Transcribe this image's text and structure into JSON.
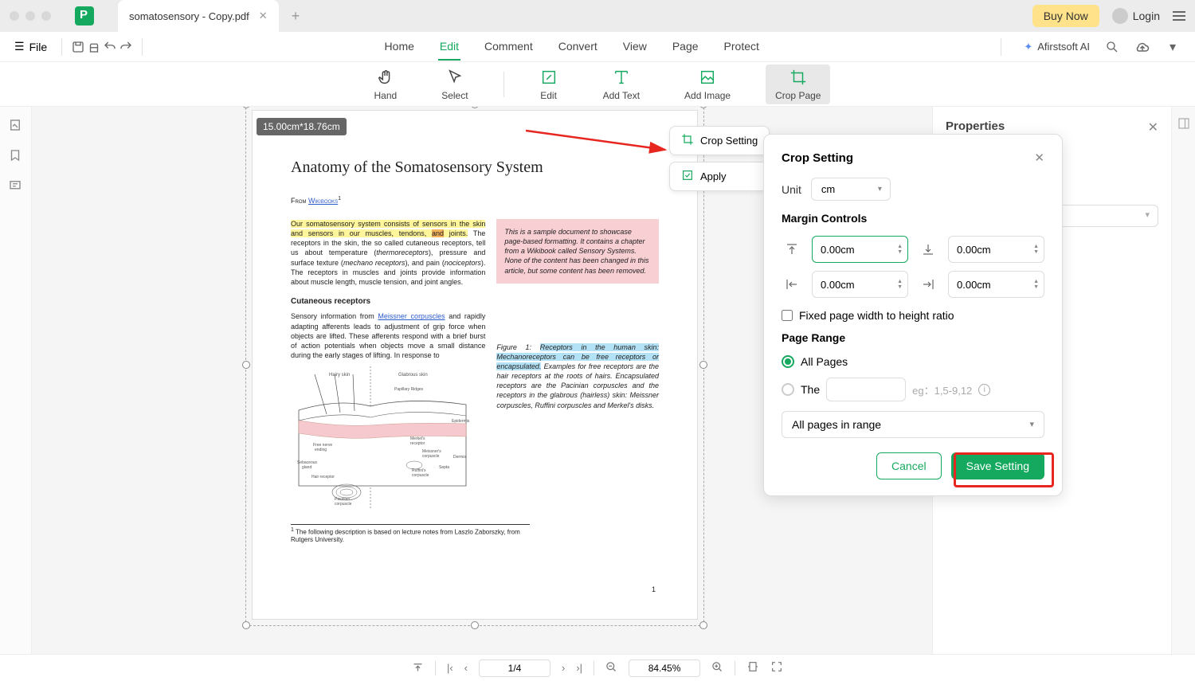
{
  "titlebar": {
    "tab_name": "somatosensory - Copy.pdf",
    "buy_now": "Buy Now",
    "login": "Login"
  },
  "menubar": {
    "file": "File",
    "items": [
      "Home",
      "Edit",
      "Comment",
      "Convert",
      "View",
      "Page",
      "Protect"
    ],
    "active_index": 1,
    "ai": "Afirstsoft AI"
  },
  "toolbar": {
    "items": [
      "Hand",
      "Select",
      "Edit",
      "Add Text",
      "Add Image",
      "Crop Page"
    ],
    "active_index": 5
  },
  "canvas": {
    "size_badge": "15.00cm*18.76cm",
    "float_crop_setting": "Crop Setting",
    "float_apply": "Apply"
  },
  "document": {
    "title": "Anatomy of the Somatosensory System",
    "from_label": "From ",
    "from_link": "Wikibooks",
    "body_hl1": "Our somatosensory system consists of sensors in the skin",
    "body_hl2": "and sensors in our muscles, tendons, ",
    "body_hl3": "and",
    "body_hl4": " joints.",
    "body_rest1": " The receptors in the skin, the so called cutaneous receptors, tell us about temperature (",
    "body_em1": "thermoreceptors",
    "body_rest2": "), pressure and surface texture (",
    "body_em2": "mechano receptors",
    "body_rest3": "), and pain (",
    "body_em3": "nociceptors",
    "body_rest4": "). The receptors in muscles and joints provide information about muscle length, muscle tension, and joint angles.",
    "pinkbox": "This is a sample document to showcase page-based formatting. It contains a chapter from a Wikibook called Sensory Systems. None of the content has been changed in this article, but some content has been removed.",
    "subhead": "Cutaneous receptors",
    "para2a": "Sensory information from ",
    "para2link": "Meissner corpuscles",
    "para2b": " and rapidly adapting afferents leads to adjustment of grip force when objects are lifted. These afferents respond with a brief burst of action potentials when objects move a small distance during the early stages of lifting. In response to",
    "fig_label": "Figure 1:",
    "fig_hl": "Receptors in the human skin: Mechanoreceptors can be free receptors or encapsulated.",
    "fig_rest": " Examples for free receptors are the hair receptors at the roots of hairs. Encapsulated receptors are the Pacinian corpuscles and the receptors in the glabrous (hairless) skin: Meissner corpuscles, Ruffini corpuscles and Merkel's disks.",
    "diagram_labels": [
      "Hairy skin",
      "Glabrous skin",
      "Papillary Ridges",
      "Epidermis",
      "Dermis",
      "Free nerve ending",
      "Merkel's receptor",
      "Meissner's corpuscle",
      "Septa",
      "Ruffini's corpuscle",
      "Hair receptor",
      "Sebaceous gland",
      "Pacinian corpuscle"
    ],
    "footnote_marker": "1",
    "footnote": " The following description is based on lecture notes from Laszlo Zaborszky, from Rutgers University.",
    "page_num": "1"
  },
  "right_panel": {
    "title": "Properties"
  },
  "modal": {
    "title": "Crop Setting",
    "unit_label": "Unit",
    "unit_value": "cm",
    "margin_title": "Margin Controls",
    "margin_top": "0.00cm",
    "margin_bottom": "0.00cm",
    "margin_left": "0.00cm",
    "margin_right": "0.00cm",
    "fixed_ratio": "Fixed page width to height ratio",
    "page_range_title": "Page Range",
    "all_pages": "All Pages",
    "the_label": "The",
    "range_hint": "eg：1,5-9,12",
    "apply_select": "All pages in range",
    "cancel": "Cancel",
    "save": "Save Setting"
  },
  "statusbar": {
    "page": "1/4",
    "zoom": "84.45%"
  }
}
